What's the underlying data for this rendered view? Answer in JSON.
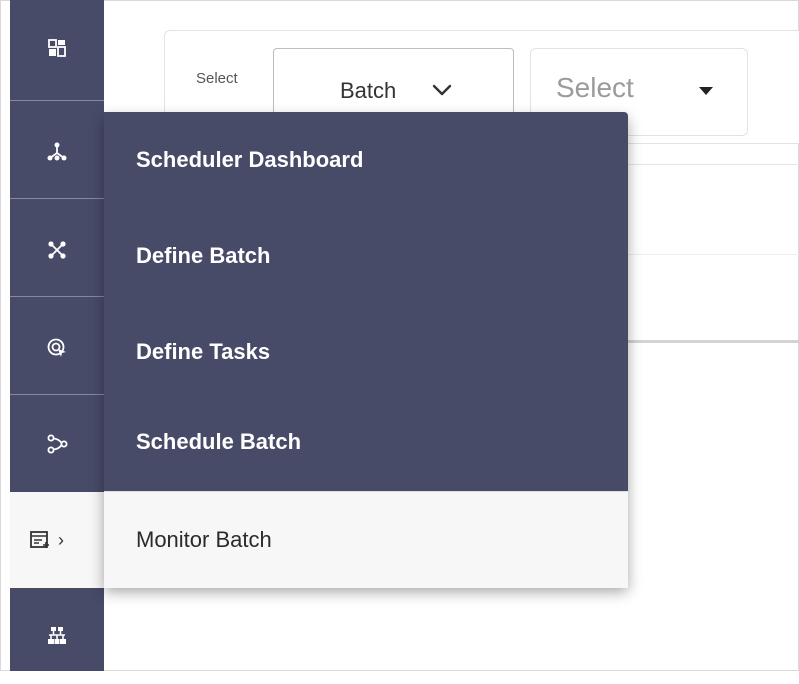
{
  "filters": {
    "select_label": "Select",
    "batch_dropdown": {
      "value": "Batch"
    },
    "secondary_dropdown": {
      "placeholder": "Select"
    }
  },
  "rail": {
    "icons": [
      "dashboard-grid-icon",
      "hierarchy-icon",
      "network-nodes-icon",
      "target-cursor-icon",
      "workflow-icon",
      "task-list-icon",
      "org-chart-icon"
    ],
    "active_index": 5,
    "active_chevron": "›"
  },
  "menu": {
    "items": [
      {
        "label": "Scheduler Dashboard"
      },
      {
        "label": "Define Batch"
      },
      {
        "label": "Define Tasks"
      },
      {
        "label": "Schedule Batch"
      },
      {
        "label": "Monitor Batch"
      }
    ],
    "highlighted_index": 4
  },
  "colors": {
    "rail_bg": "#474b68",
    "menu_bg": "#474b68",
    "menu_text": "#ffffff",
    "highlight_bg": "#f7f7f7"
  }
}
